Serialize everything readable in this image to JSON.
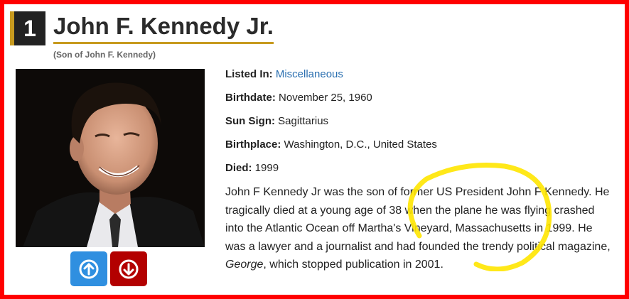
{
  "entry": {
    "rank": "1",
    "name": "John F. Kennedy Jr.",
    "subtitle": "(Son of John F. Kennedy)"
  },
  "details": {
    "listed_in_label": "Listed In:",
    "listed_in_value": "Miscellaneous",
    "birthdate_label": "Birthdate:",
    "birthdate_value": "November 25, 1960",
    "sun_sign_label": "Sun Sign:",
    "sun_sign_value": "Sagittarius",
    "birthplace_label": "Birthplace:",
    "birthplace_value": "Washington, D.C., United States",
    "died_label": "Died:",
    "died_value": "1999"
  },
  "bio": {
    "part1": "John F Kennedy Jr was the son of former US President John F Kennedy. He tragically died at a young age of 38 when the plane he was flying crashed into the Atlantic Ocean off Martha's Vineyard, Massachusetts in 1999. He was a lawyer and a journalist and had founded the trendy political magazine, ",
    "magazine": "George",
    "part2": ", which stopped publication in 2001."
  },
  "icons": {
    "upvote": "arrow-up-circle-icon",
    "downvote": "arrow-down-circle-icon"
  },
  "colors": {
    "frame": "#ff0000",
    "accent_gold": "#c79a1f",
    "rank_bg": "#222222",
    "upvote_bg": "#2f8fe0",
    "downvote_bg": "#b30000",
    "link": "#2a6fb0",
    "annotation": "#ffe600"
  }
}
